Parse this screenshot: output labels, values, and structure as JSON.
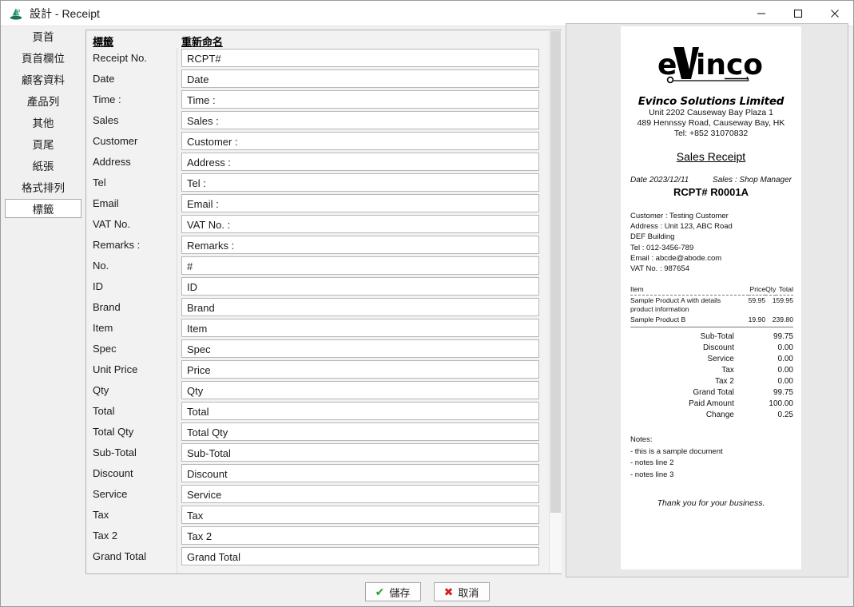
{
  "window": {
    "title": "設計 - Receipt",
    "icon": "app-icon",
    "minimize": "—",
    "maximize": "□",
    "close": "✕"
  },
  "sidebar": {
    "items": [
      {
        "label": "頁首",
        "selected": false
      },
      {
        "label": "頁首欄位",
        "selected": false
      },
      {
        "label": "顧客資料",
        "selected": false
      },
      {
        "label": "產品列",
        "selected": false
      },
      {
        "label": "其他",
        "selected": false
      },
      {
        "label": "頁尾",
        "selected": false
      },
      {
        "label": "紙張",
        "selected": false
      },
      {
        "label": "格式排列",
        "selected": false
      },
      {
        "label": "標籤",
        "selected": true
      }
    ]
  },
  "form": {
    "columns": {
      "label": "標籤",
      "rename": "重新命名"
    },
    "rows": [
      {
        "label": "Receipt No.",
        "value": "RCPT#"
      },
      {
        "label": "Date",
        "value": "Date"
      },
      {
        "label": "Time :",
        "value": "Time :"
      },
      {
        "label": "Sales",
        "value": "Sales :"
      },
      {
        "label": "Customer",
        "value": "Customer :"
      },
      {
        "label": "Address",
        "value": "Address :"
      },
      {
        "label": "Tel",
        "value": "Tel :"
      },
      {
        "label": "Email",
        "value": "Email :"
      },
      {
        "label": "VAT No.",
        "value": "VAT No. :"
      },
      {
        "label": "Remarks :",
        "value": "Remarks :"
      },
      {
        "label": "No.",
        "value": "#"
      },
      {
        "label": "ID",
        "value": "ID"
      },
      {
        "label": "Brand",
        "value": "Brand"
      },
      {
        "label": "Item",
        "value": "Item"
      },
      {
        "label": "Spec",
        "value": "Spec"
      },
      {
        "label": "Unit Price",
        "value": "Price"
      },
      {
        "label": "Qty",
        "value": "Qty"
      },
      {
        "label": "Total",
        "value": "Total"
      },
      {
        "label": "Total Qty",
        "value": "Total Qty"
      },
      {
        "label": "Sub-Total",
        "value": "Sub-Total"
      },
      {
        "label": "Discount",
        "value": "Discount"
      },
      {
        "label": "Service",
        "value": "Service"
      },
      {
        "label": "Tax",
        "value": "Tax"
      },
      {
        "label": "Tax 2",
        "value": "Tax 2"
      },
      {
        "label": "Grand Total",
        "value": "Grand Total"
      }
    ]
  },
  "preview": {
    "logo_text": "eVinco",
    "company": "Evinco Solutions Limited",
    "address_lines": [
      "Unit 2202 Causeway Bay Plaza 1",
      "489 Hennssy Road, Causeway Bay, HK",
      "Tel: +852 31070832"
    ],
    "doc_title": "Sales Receipt",
    "date_label": "Date 2023/12/11",
    "sales_label": "Sales : Shop Manager",
    "receipt_no": "RCPT# R0001A",
    "customer_lines": [
      "Customer : Testing Customer",
      "Address : Unit 123, ABC Road",
      "DEF Building",
      "Tel : 012-3456-789",
      "Email : abcde@abode.com",
      "VAT No. : 987654"
    ],
    "items_header": [
      "Item",
      "Price",
      "Qty",
      "Total"
    ],
    "items": [
      {
        "name": "Sample Product A with details product information",
        "price": "59.95",
        "qty": "1",
        "total": "59.95"
      },
      {
        "name": "Sample Product B",
        "price": "19.90",
        "qty": "2",
        "total": "39.80"
      }
    ],
    "totals": [
      {
        "key": "Sub-Total",
        "value": "99.75"
      },
      {
        "key": "Discount",
        "value": "0.00"
      },
      {
        "key": "Service",
        "value": "0.00"
      },
      {
        "key": "Tax",
        "value": "0.00"
      },
      {
        "key": "Tax 2",
        "value": "0.00"
      },
      {
        "key": "Grand Total",
        "value": "99.75"
      },
      {
        "key": "Paid Amount",
        "value": "100.00"
      },
      {
        "key": "Change",
        "value": "0.25"
      }
    ],
    "notes_title": "Notes:",
    "notes": [
      "- this is a sample document",
      "- notes line 2",
      "- notes line 3"
    ],
    "thanks": "Thank you for your business."
  },
  "footer": {
    "save_label": "儲存",
    "save_glyph": "✔",
    "cancel_label": "取消",
    "cancel_glyph": "✖"
  },
  "colors": {
    "accent_ok": "#2aa02a",
    "accent_no": "#d32020",
    "panel_bg": "#f0f0f0"
  }
}
